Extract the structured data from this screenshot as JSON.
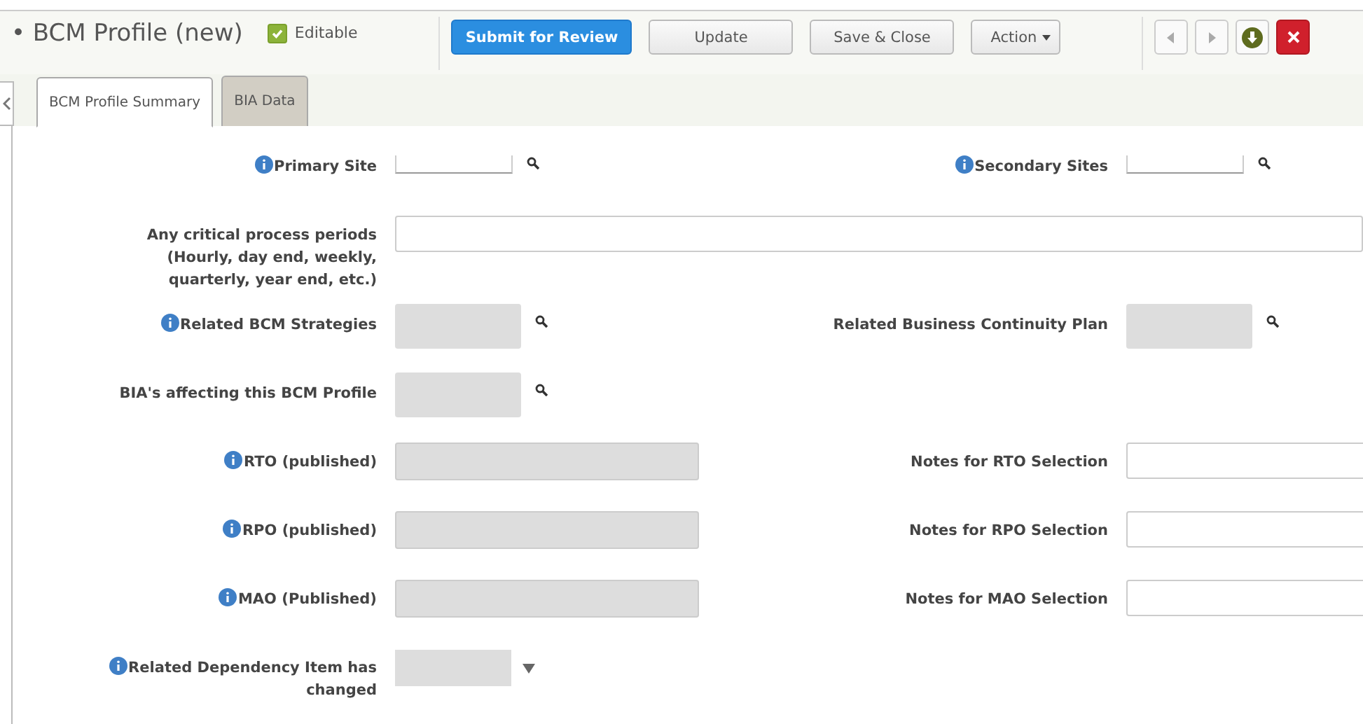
{
  "header": {
    "title": "• BCM Profile (new)",
    "editable": {
      "label": "Editable",
      "checked": true
    }
  },
  "toolbar": {
    "buttons": [
      {
        "label": "Submit for Review",
        "kind": "primary"
      },
      {
        "label": "Update",
        "kind": "plain"
      },
      {
        "label": "Save & Close",
        "kind": "plain"
      },
      {
        "label": "Action",
        "kind": "menu"
      }
    ]
  },
  "tabs": [
    {
      "label": "BCM Profile Summary",
      "selected": true
    },
    {
      "label": "BIA Data",
      "selected": false
    }
  ],
  "rows": [
    {
      "left": {
        "label": "Primary Site",
        "info": true,
        "kind": "lookup"
      },
      "right": {
        "label": "Secondary Sites",
        "info": true,
        "kind": "lookup"
      }
    },
    {
      "left": {
        "label": "Any critical process periods (Hourly, day end, weekly, quarterly, year end, etc.)",
        "info": false,
        "kind": "wide_text"
      }
    },
    {
      "left": {
        "label": "Related BCM Strategies",
        "info": true,
        "kind": "lookup_box"
      },
      "right": {
        "label": "Related Business Continuity Plan",
        "info": false,
        "kind": "lookup_box"
      }
    },
    {
      "left": {
        "label": "BIA's affecting this BCM Profile",
        "info": false,
        "kind": "lookup_box"
      }
    },
    {
      "left": {
        "label": "RTO (published)",
        "info": true,
        "kind": "readonly"
      },
      "right": {
        "label": "Notes for RTO Selection",
        "info": false,
        "kind": "text"
      }
    },
    {
      "left": {
        "label": "RPO (published)",
        "info": true,
        "kind": "readonly"
      },
      "right": {
        "label": "Notes for RPO Selection",
        "info": false,
        "kind": "text"
      }
    },
    {
      "left": {
        "label": "MAO (Published)",
        "info": true,
        "kind": "readonly"
      },
      "right": {
        "label": "Notes for MAO Selection",
        "info": false,
        "kind": "text"
      }
    },
    {
      "left": {
        "label": "Related Dependency Item has changed",
        "info": true,
        "kind": "select"
      }
    }
  ]
}
